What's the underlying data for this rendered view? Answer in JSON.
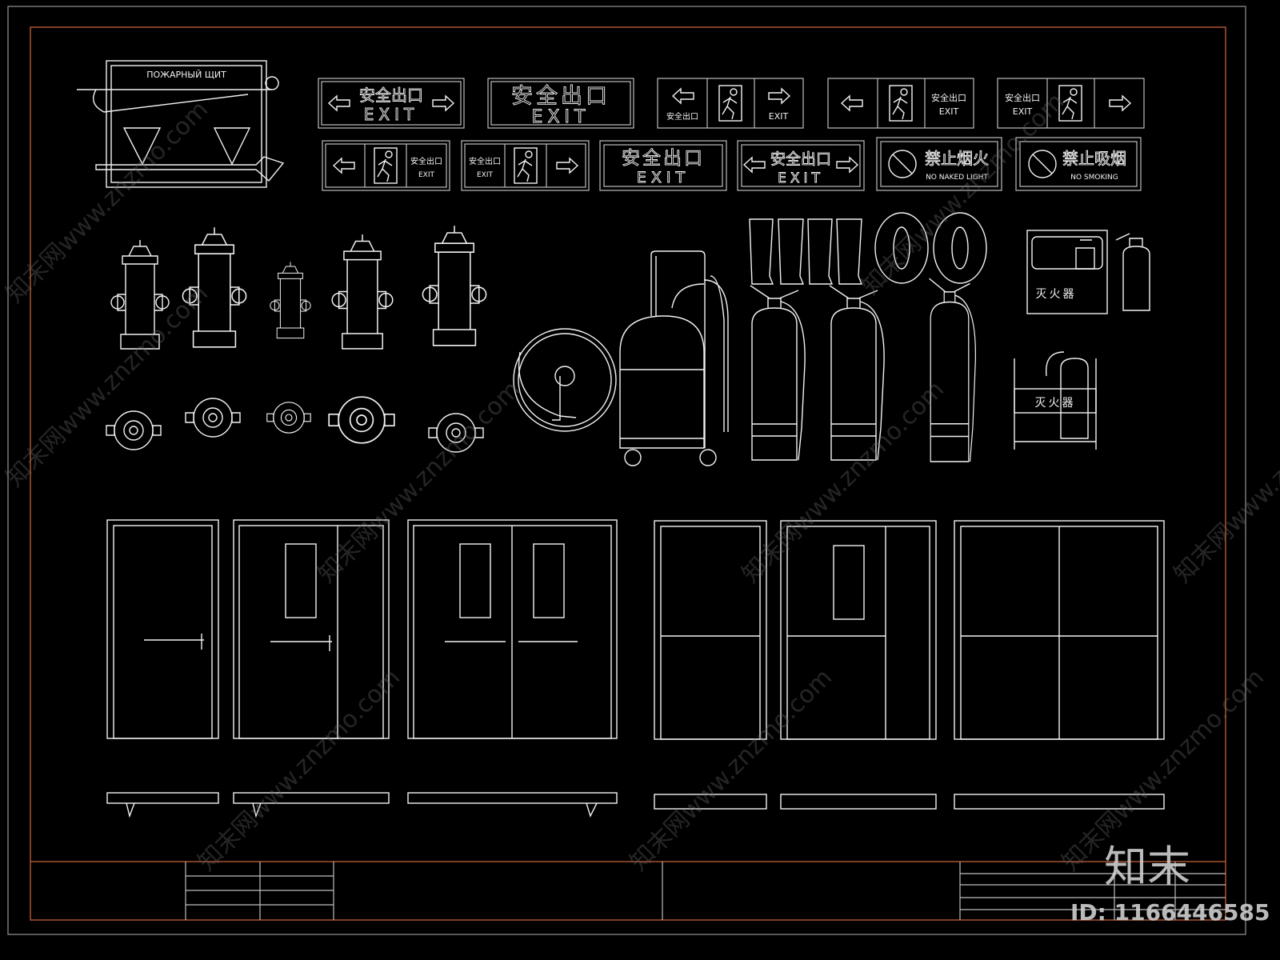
{
  "colors": {
    "background": "#000000",
    "lines": "#f2f2f2",
    "frame": "#c8603a",
    "outer_border": "#8a8a8a"
  },
  "fire_cabinet": {
    "label": "ПОЖАРНЫЙ ЩИТ"
  },
  "signs": {
    "exit_cn": "安全出口",
    "exit_en": "EXIT",
    "no_fire_cn": "禁止烟火",
    "no_fire_en": "NO NAKED LIGHT",
    "no_smoking_cn": "禁止吸烟",
    "no_smoking_en": "NO SMOKING"
  },
  "extinguisher_box": {
    "label": "灭火器"
  },
  "extinguisher_stand": {
    "label": "灭火器"
  },
  "watermark": {
    "text": "知末网www.znzmo.com",
    "brand": "知末",
    "id": "ID: 1166446585"
  }
}
